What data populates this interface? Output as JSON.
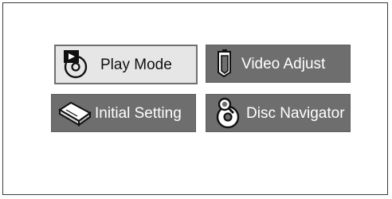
{
  "menu": {
    "items": [
      {
        "label": "Play Mode",
        "icon": "play-disc-icon",
        "selected": true
      },
      {
        "label": "Video Adjust",
        "icon": "video-adjust-icon",
        "selected": false
      },
      {
        "label": "Initial Setting",
        "icon": "initial-setting-icon",
        "selected": false
      },
      {
        "label": "Disc Navigator",
        "icon": "disc-navigator-icon",
        "selected": false
      }
    ]
  },
  "colors": {
    "selected_background": "#e6e6e6",
    "button_background": "#6e6e6e",
    "button_text": "#ffffff",
    "selected_text": "#111111",
    "frame_border": "#3a3a3a"
  }
}
